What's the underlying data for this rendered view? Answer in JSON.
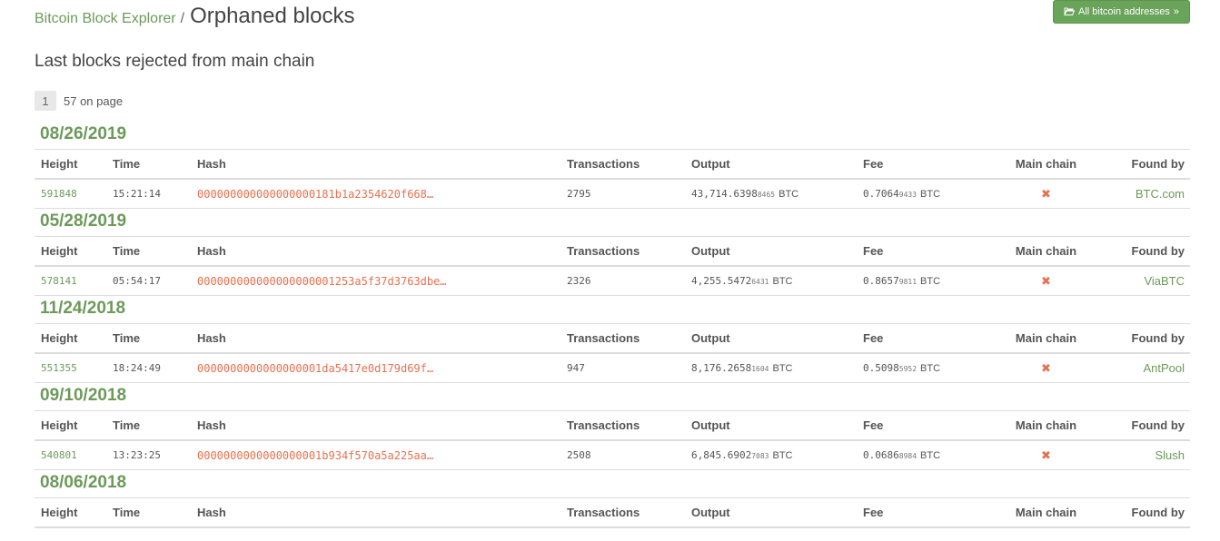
{
  "header": {
    "breadcrumb_link": "Bitcoin Block Explorer",
    "separator": "/",
    "title": "Orphaned blocks"
  },
  "top_button": {
    "icon": "folder-open-icon",
    "label": "All bitcoin addresses",
    "chevron": "»"
  },
  "subtitle": "Last blocks rejected from main chain",
  "pager": {
    "current": "1",
    "count_text": "57 on page"
  },
  "columns": {
    "height": "Height",
    "time": "Time",
    "hash": "Hash",
    "transactions": "Transactions",
    "output": "Output",
    "fee": "Fee",
    "main_chain": "Main chain",
    "found_by": "Found by"
  },
  "colors": {
    "accent_green": "#6c9a59",
    "link_orange": "#e8704f",
    "button_green": "#6aa35a"
  },
  "groups": [
    {
      "date": "08/26/2019",
      "rows": [
        {
          "height": "591848",
          "time": "15:21:14",
          "hash": "000000000000000000181b1a2354620f668…",
          "transactions": "2795",
          "output_main": "43,714.6398",
          "output_small": "8465",
          "output_unit": "BTC",
          "fee_main": "0.7064",
          "fee_small": "9433",
          "fee_unit": "BTC",
          "main_chain": "✖",
          "found_by": "BTC.com"
        }
      ]
    },
    {
      "date": "05/28/2019",
      "rows": [
        {
          "height": "578141",
          "time": "05:54:17",
          "hash": "000000000000000000001253a5f37d3763dbe…",
          "transactions": "2326",
          "output_main": "4,255.5472",
          "output_small": "6431",
          "output_unit": "BTC",
          "fee_main": "0.8657",
          "fee_small": "9811",
          "fee_unit": "BTC",
          "main_chain": "✖",
          "found_by": "ViaBTC"
        }
      ]
    },
    {
      "date": "11/24/2018",
      "rows": [
        {
          "height": "551355",
          "time": "18:24:49",
          "hash": "0000000000000000001da5417e0d179d69f…",
          "transactions": "947",
          "output_main": "8,176.2658",
          "output_small": "1604",
          "output_unit": "BTC",
          "fee_main": "0.5098",
          "fee_small": "5952",
          "fee_unit": "BTC",
          "main_chain": "✖",
          "found_by": "AntPool"
        }
      ]
    },
    {
      "date": "09/10/2018",
      "rows": [
        {
          "height": "540801",
          "time": "13:23:25",
          "hash": "0000000000000000001b934f570a5a225aa…",
          "transactions": "2508",
          "output_main": "6,845.6902",
          "output_small": "7083",
          "output_unit": "BTC",
          "fee_main": "0.0686",
          "fee_small": "8984",
          "fee_unit": "BTC",
          "main_chain": "✖",
          "found_by": "Slush"
        }
      ]
    },
    {
      "date": "08/06/2018",
      "rows": []
    }
  ]
}
